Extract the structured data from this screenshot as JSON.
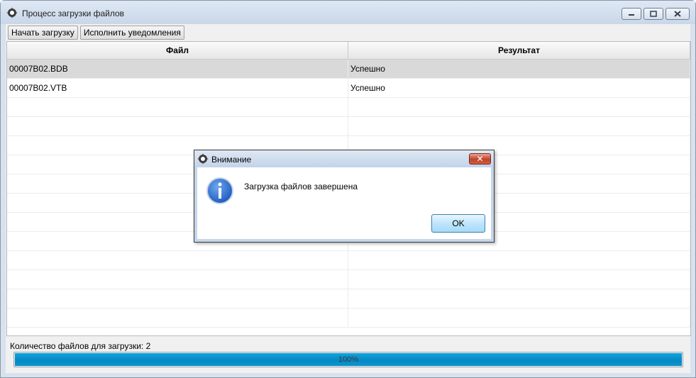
{
  "window": {
    "title": "Процесс загрузки файлов",
    "app_icon": "gear-icon"
  },
  "toolbar": {
    "start_label": "Начать загрузку",
    "notify_label": "Исполнить уведомления"
  },
  "grid": {
    "columns": [
      "Файл",
      "Результат"
    ],
    "rows": [
      {
        "file": "00007B02.BDB",
        "result": "Успешно",
        "selected": true
      },
      {
        "file": "00007B02.VTB",
        "result": "Успешно",
        "selected": false
      }
    ],
    "empty_rows": 12
  },
  "status": {
    "files_count_label": "Количество файлов для загрузки: 2",
    "progress_value": 100,
    "progress_text": "100%"
  },
  "dialog": {
    "title": "Внимание",
    "message": "Загрузка файлов завершена",
    "ok_label": "OK",
    "icon": "info-icon"
  },
  "colors": {
    "progress_fill": "#0a95cf",
    "selected_row": "#d9d9d9",
    "window_frame": "#d7e2ef"
  }
}
